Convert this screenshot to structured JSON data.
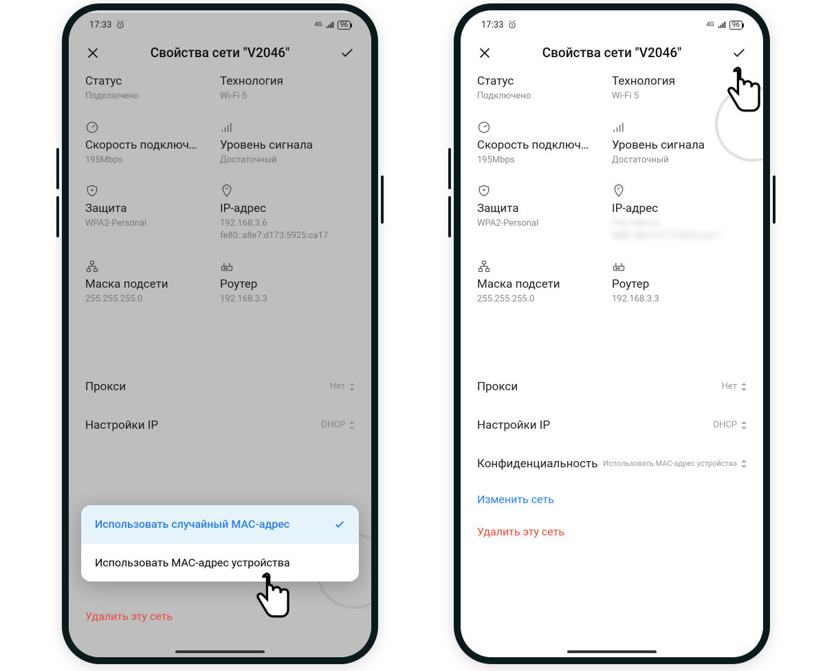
{
  "status": {
    "time": "17:33",
    "network_indicator": "4G",
    "battery": "96"
  },
  "header": {
    "title": "Свойства сети \"V2046\""
  },
  "info": {
    "status_label": "Статус",
    "status_value": "Подключено",
    "tech_label": "Технология",
    "tech_value": "Wi-Fi 5",
    "speed_label": "Скорость подключ…",
    "speed_value": "195Mbps",
    "signal_label": "Уровень сигнала",
    "signal_value": "Достаточный",
    "security_label": "Защита",
    "security_value": "WPA2-Personal",
    "ip_label": "IP-адрес",
    "ip_value_line1": "192.168.3.6",
    "ip_value_line2": "fe80::a8e7:d173:5925:ca17",
    "subnet_label": "Маска подсети",
    "subnet_value": "255.255.255.0",
    "router_label": "Роутер",
    "router_value": "192.168.3.3"
  },
  "settings": {
    "proxy_label": "Прокси",
    "proxy_value": "Нет",
    "ip_settings_label": "Настройки IP",
    "ip_settings_value": "DHCP",
    "privacy_label": "Конфиденциальность",
    "privacy_value": "Использовать MAC-адрес устройства"
  },
  "popup": {
    "option_random": "Использовать случайный MAC-адрес",
    "option_device": "Использовать MAC-адрес устройства"
  },
  "actions": {
    "modify": "Изменить сеть",
    "delete": "Удалить эту сеть"
  }
}
